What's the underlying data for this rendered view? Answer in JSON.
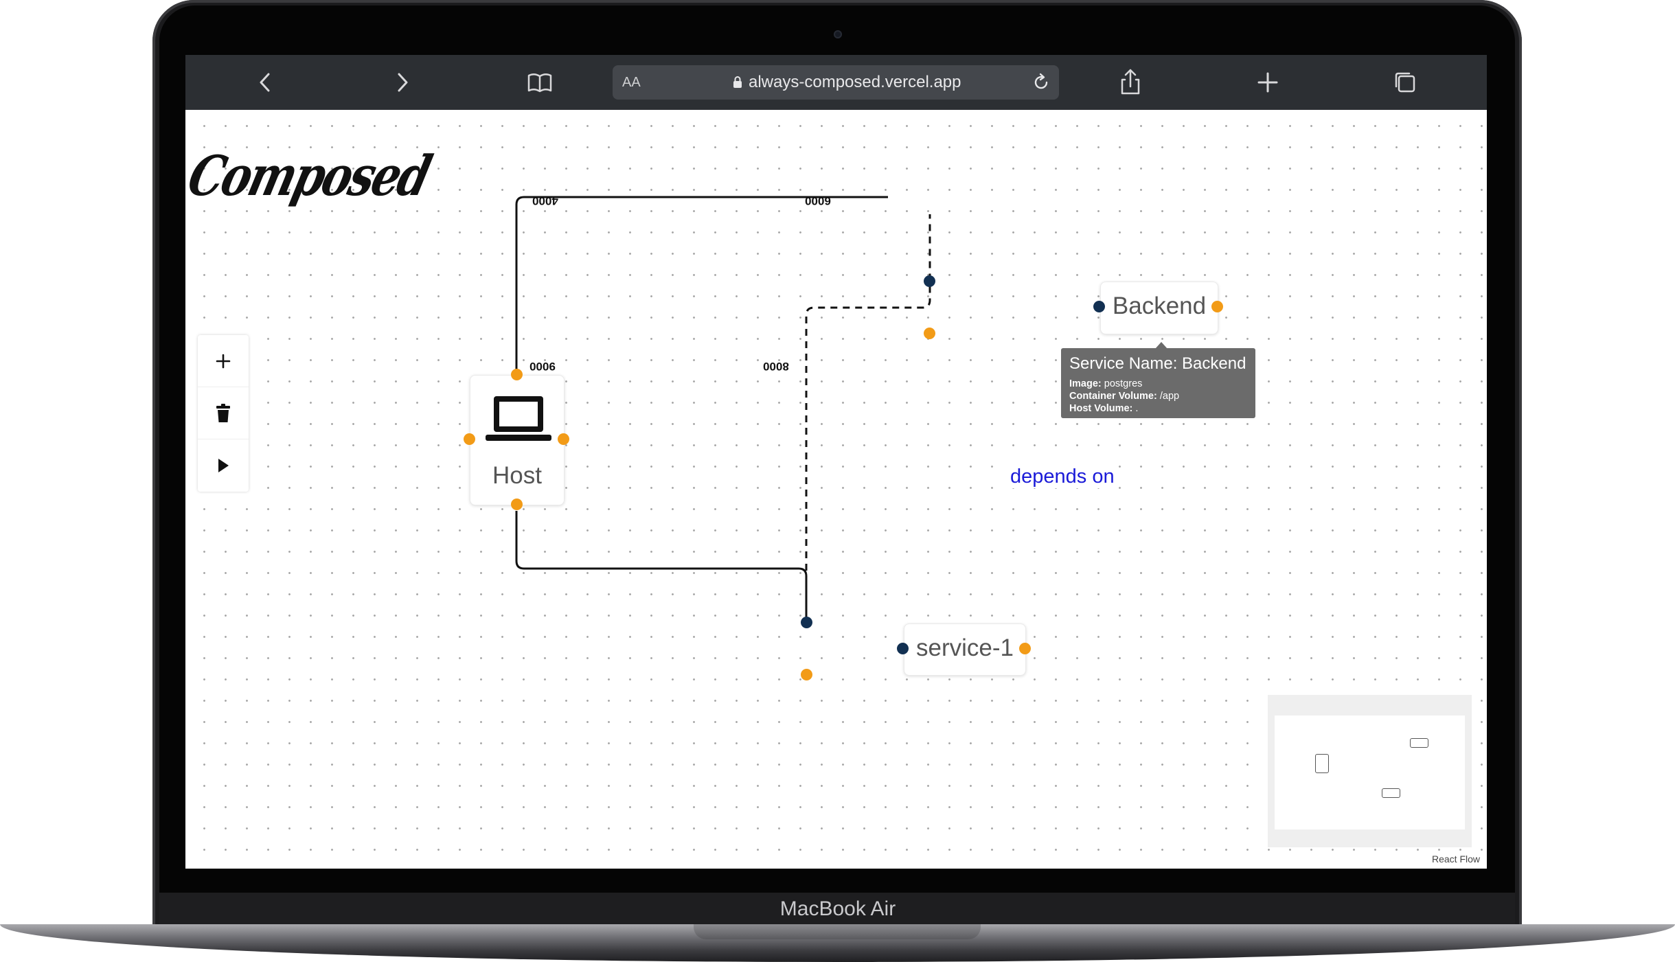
{
  "device": {
    "label": "MacBook Air"
  },
  "browser": {
    "text_size_label": "AA",
    "url": "always-composed.vercel.app",
    "icons": [
      "chevron-left-icon",
      "chevron-right-icon",
      "book-icon",
      "lock-icon",
      "reload-icon",
      "share-icon",
      "plus-icon",
      "tabs-icon"
    ]
  },
  "app": {
    "logo": "Composed",
    "controls": [
      {
        "name": "add-node-button",
        "icon": "plus-icon",
        "glyph": "+"
      },
      {
        "name": "delete-button",
        "icon": "trash-icon",
        "glyph": ""
      },
      {
        "name": "run-button",
        "icon": "play-icon",
        "glyph": "▶"
      }
    ],
    "nodes": {
      "host": {
        "label": "Host",
        "icon": "laptop-icon"
      },
      "backend": {
        "label": "Backend"
      },
      "service": {
        "label": "service-1"
      }
    },
    "tooltip": {
      "title": "Service Name: Backend",
      "lines": [
        {
          "key": "Image:",
          "value": " postgres"
        },
        {
          "key": "Container Volume:",
          "value": " /app"
        },
        {
          "key": "Host Volume:",
          "value": " ."
        }
      ]
    },
    "edges": {
      "host_backend": {
        "source_port": "4000",
        "target_port": "6000"
      },
      "host_service": {
        "source_port": "9000",
        "target_port": "8000"
      },
      "dependency": {
        "label": "depends on"
      }
    },
    "attribution": "React Flow",
    "colors": {
      "handle_output": "#f29b17",
      "handle_input": "#123052",
      "dependency_label": "#1a1ad8",
      "tooltip_bg": "#6b6b6b"
    }
  }
}
